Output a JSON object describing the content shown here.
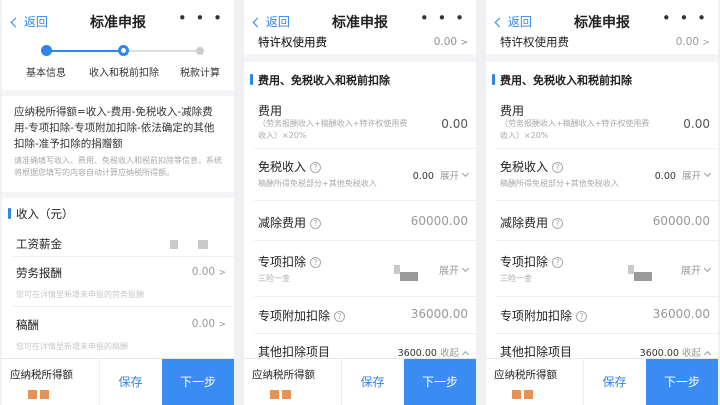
{
  "nav": {
    "back_label": "返回",
    "title": "标准申报",
    "more": "• • •"
  },
  "steps": {
    "items": [
      "基本信息",
      "收入和税前扣除",
      "税款计算"
    ],
    "current": 1
  },
  "panel1": {
    "formula": "应纳税所得额=收入-费用-免税收入-减除费用-专项扣除-专项附加扣除-依法确定的其他扣除-准予扣除的捐赠额",
    "tip": "请准确填写收入、费用、免税收入和税前扣除等信息，系统将根据您填写的内容自动计算应纳税所得额。",
    "section": "收入（元）",
    "rows": [
      {
        "label": "工资薪金",
        "value": ""
      },
      {
        "label": "劳务报酬",
        "value": "0.00",
        "hint": "您可在详情里新增未申报的劳务报酬"
      },
      {
        "label": "稿酬",
        "value": "0.00",
        "hint": "您可在详情里新增未申报的稿酬"
      }
    ]
  },
  "panel2": {
    "top_row": {
      "label": "特许权使用费",
      "value": "0.00"
    },
    "section": "费用、免税收入和税前扣除",
    "fee": {
      "label": "费用",
      "sub": "（劳务报酬收入+稿酬收入+特许权使用费收入）×20%",
      "value": "0.00"
    },
    "tax_free": {
      "label": "免税收入",
      "sub": "稿酬所得免税部分+其他免税收入",
      "value": "0.00",
      "action": "展开"
    },
    "deduction": {
      "label": "减除费用",
      "value": "60000.00"
    },
    "special": {
      "label": "专项扣除",
      "sub": "三险一金",
      "action": "展开"
    },
    "special_additional": {
      "label": "专项附加扣除",
      "value": "36000.00"
    },
    "other": {
      "label": "其他扣除项目",
      "value": "3600.00",
      "action": "收起"
    }
  },
  "bottom": {
    "label": "应纳税所得额",
    "save": "保存",
    "next": "下一步"
  },
  "colors": {
    "accent": "#2d86e8",
    "button": "#3b8cf2",
    "redacted": "#e59254"
  }
}
